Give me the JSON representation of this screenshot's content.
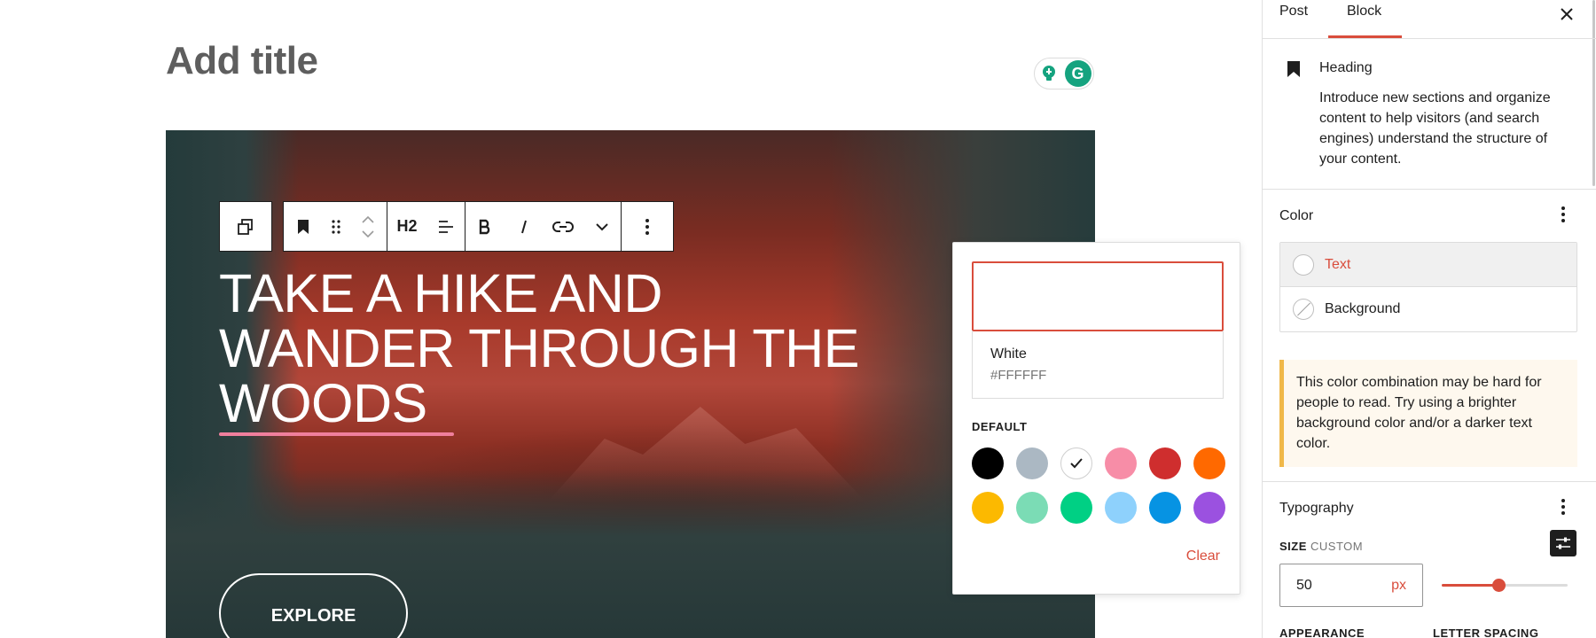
{
  "editor": {
    "title_placeholder": "Add title",
    "heading_text": "TAKE A HIKE AND WANDER THROUGH THE WOODS",
    "button_text": "EXPLORE"
  },
  "toolbar": {
    "heading_level": "H2",
    "icons": [
      "cover-select-icon",
      "bookmark-icon",
      "drag-handle-icon",
      "move-up-icon",
      "move-down-icon",
      "align-icon",
      "bold-icon",
      "italic-icon",
      "link-icon",
      "more-icon",
      "options-icon"
    ]
  },
  "color_popover": {
    "selected_name": "White",
    "selected_hex": "#FFFFFF",
    "section_label": "DEFAULT",
    "clear_label": "Clear",
    "palette": [
      "#000000",
      "#abb8c3",
      "#ffffff",
      "#f78da7",
      "#cf2e2e",
      "#ff6900",
      "#fcb900",
      "#7bdcb5",
      "#00d084",
      "#8ed1fc",
      "#0693e3",
      "#9b51e0"
    ],
    "selected_index": 2
  },
  "sidebar": {
    "tabs": [
      "Post",
      "Block"
    ],
    "active_tab": "Block",
    "block": {
      "name": "Heading",
      "description": "Introduce new sections and organize content to help visitors (and search engines) understand the structure of your content."
    },
    "color_panel": {
      "title": "Color",
      "items": [
        {
          "label": "Text",
          "active": true
        },
        {
          "label": "Background",
          "active": false
        }
      ],
      "warning": "This color combination may be hard for people to read. Try using a brighter background color and/or a darker text color."
    },
    "typography": {
      "title": "Typography",
      "size_label": "SIZE",
      "size_mode": "CUSTOM",
      "size_value": "50",
      "size_unit": "px",
      "slider_fraction": 0.45,
      "appearance_label": "APPEARANCE",
      "letter_spacing_label": "LETTER SPACING"
    }
  },
  "colors": {
    "accent": "#d94d3c",
    "warning_border": "#f0b849"
  }
}
